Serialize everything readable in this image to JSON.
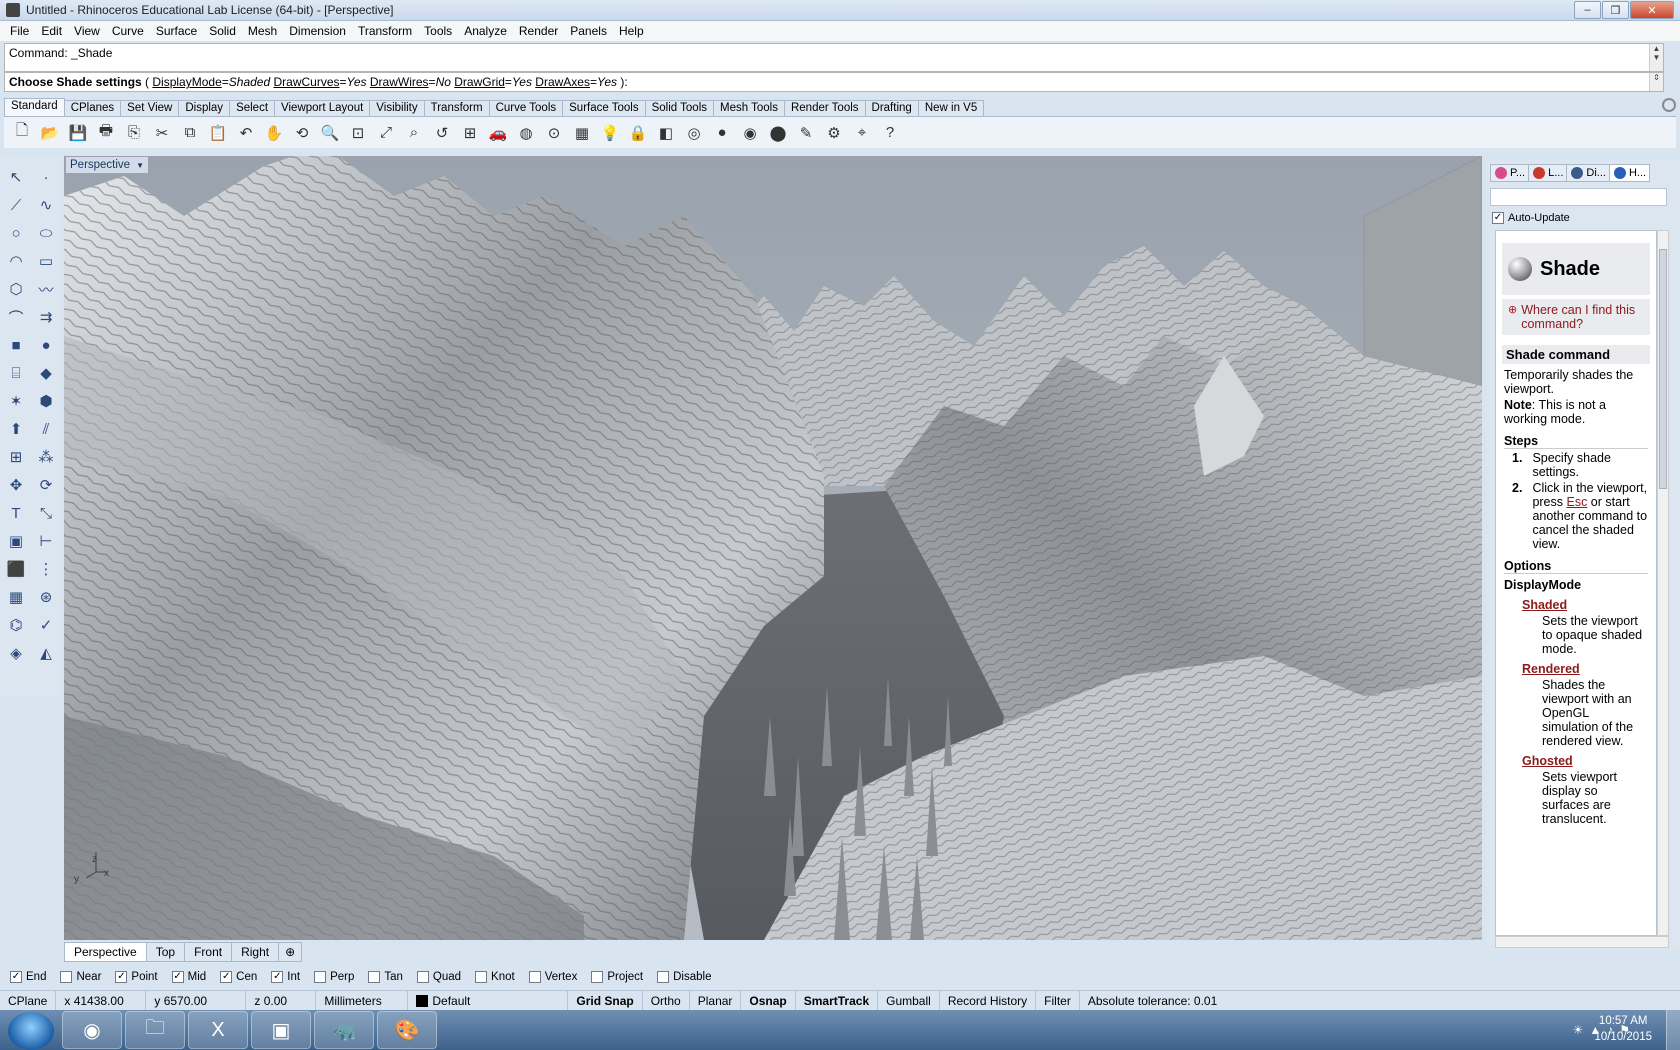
{
  "window": {
    "title": "Untitled - Rhinoceros Educational Lab License (64-bit) - [Perspective]",
    "min": "–",
    "max": "❐",
    "close": "✕"
  },
  "menu": [
    "File",
    "Edit",
    "View",
    "Curve",
    "Surface",
    "Solid",
    "Mesh",
    "Dimension",
    "Transform",
    "Tools",
    "Analyze",
    "Render",
    "Panels",
    "Help"
  ],
  "command": {
    "history": "Command: _Shade",
    "prompt": "Choose Shade settings",
    "open": " ( ",
    "options": [
      {
        "name": "DisplayMode",
        "value": "Shaded"
      },
      {
        "name": "DrawCurves",
        "value": "Yes"
      },
      {
        "name": "DrawWires",
        "value": "No"
      },
      {
        "name": "DrawGrid",
        "value": "Yes"
      },
      {
        "name": "DrawAxes",
        "value": "Yes"
      }
    ],
    "close": " ):"
  },
  "toolbar_tabs": [
    "Standard",
    "CPlanes",
    "Set View",
    "Display",
    "Select",
    "Viewport Layout",
    "Visibility",
    "Transform",
    "Curve Tools",
    "Surface Tools",
    "Solid Tools",
    "Mesh Tools",
    "Render Tools",
    "Drafting",
    "New in V5"
  ],
  "toolbar_icons": [
    "new-file-icon",
    "open-file-icon",
    "save-icon",
    "print-icon",
    "import-icon",
    "cut-icon",
    "copy-icon",
    "paste-icon",
    "undo-icon",
    "pan-hand-icon",
    "rotate-view-icon",
    "zoom-icon",
    "zoom-window-icon",
    "zoom-extents-icon",
    "zoom-selected-icon",
    "undo-view-icon",
    "four-viewports-icon",
    "car-icon",
    "ghost-icon",
    "mesh-icon",
    "layer-icon",
    "light-bulb-icon",
    "lock-icon",
    "material-icon",
    "color-wheel-icon",
    "shaded-sphere-icon",
    "rendered-sphere-icon",
    "render-sphere-icon",
    "highlighter-icon",
    "settings-gears-icon",
    "gumball-icon",
    "help-icon"
  ],
  "left_tools": [
    "select-arrow-icon",
    "point-icon",
    "polyline-icon",
    "curve-icon",
    "circle-icon",
    "ellipse-icon",
    "arc-icon",
    "rectangle-icon",
    "polygon-icon",
    "freeform-curve-icon",
    "fillet-icon",
    "offset-icon",
    "box-icon",
    "sphere-icon",
    "cylinder-icon",
    "surface-icon",
    "explode-icon",
    "boolean-icon",
    "extrude-icon",
    "split-icon",
    "group-icon",
    "array-icon",
    "move-icon",
    "rotate-icon",
    "text-icon",
    "scale-icon",
    "block-icon",
    "dimension-icon",
    "mesh-box-icon",
    "grid-icon",
    "array-grid-icon",
    "array-polar-icon",
    "analyze-icon",
    "check-icon",
    "render-icon",
    "paint-icon"
  ],
  "viewport": {
    "name": "Perspective",
    "axis_x": "x",
    "axis_y": "y",
    "axis_z": "z",
    "tabs": [
      "Perspective",
      "Top",
      "Front",
      "Right"
    ],
    "add_tab": "⊕"
  },
  "right_panel": {
    "tabs": [
      {
        "label": "P...",
        "icon": "properties-icon",
        "color": "#d94b8c"
      },
      {
        "label": "L...",
        "icon": "layers-icon",
        "color": "#c83a2b"
      },
      {
        "label": "Di...",
        "icon": "display-icon",
        "color": "#3a5a8a"
      },
      {
        "label": "H...",
        "icon": "help-icon",
        "color": "#2a5db8"
      }
    ],
    "auto_update": "Auto-Update",
    "help": {
      "title": "Shade",
      "where": "Where can I find this command?",
      "section": "Shade command",
      "intro": "Temporarily shades the viewport.",
      "note_label": "Note",
      "note": ": This is not a working mode.",
      "steps_title": "Steps",
      "step1_num": "1.",
      "step1": "Specify shade settings.",
      "step2_num": "2.",
      "step2_a": "Click in the viewport, press ",
      "step2_esc": "Esc",
      "step2_b": " or start another command to cancel the shaded view.",
      "options_title": "Options",
      "displaymode": "DisplayMode",
      "opts": [
        {
          "name": "Shaded",
          "desc": "Sets the viewport to opaque shaded mode."
        },
        {
          "name": "Rendered",
          "desc": "Shades the viewport with an OpenGL simulation of the rendered view."
        },
        {
          "name": "Ghosted",
          "desc": "Sets viewport display so surfaces are translucent."
        }
      ]
    }
  },
  "osnap": [
    {
      "label": "End",
      "checked": true
    },
    {
      "label": "Near",
      "checked": false
    },
    {
      "label": "Point",
      "checked": true
    },
    {
      "label": "Mid",
      "checked": true
    },
    {
      "label": "Cen",
      "checked": true
    },
    {
      "label": "Int",
      "checked": true
    },
    {
      "label": "Perp",
      "checked": false
    },
    {
      "label": "Tan",
      "checked": false
    },
    {
      "label": "Quad",
      "checked": false
    },
    {
      "label": "Knot",
      "checked": false
    },
    {
      "label": "Vertex",
      "checked": false
    },
    {
      "label": "Project",
      "checked": false
    },
    {
      "label": "Disable",
      "checked": false
    }
  ],
  "status": {
    "cplane": "CPlane",
    "x": "x 41438.00",
    "y": "y 6570.00",
    "z": "z 0.00",
    "units": "Millimeters",
    "layer": "Default",
    "grid_snap": "Grid Snap",
    "ortho": "Ortho",
    "planar": "Planar",
    "osnap": "Osnap",
    "smarttrack": "SmartTrack",
    "gumball": "Gumball",
    "record_history": "Record History",
    "filter": "Filter",
    "tolerance": "Absolute tolerance: 0.01"
  },
  "taskbar": {
    "apps": [
      "chrome-icon",
      "file-explorer-icon",
      "excel-icon",
      "image-viewer-icon",
      "rhino-icon",
      "paint-icon"
    ],
    "time": "10:57 AM",
    "date": "10/10/2015"
  }
}
